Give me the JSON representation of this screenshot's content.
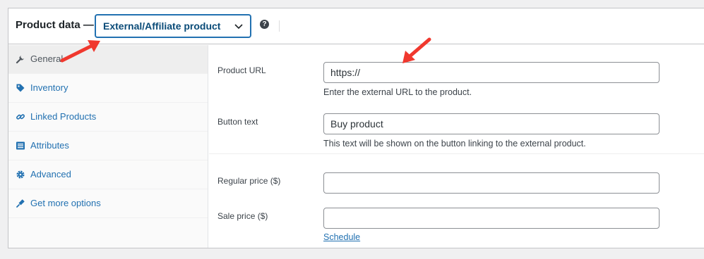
{
  "header": {
    "title": "Product data —",
    "product_type": "External/Affiliate product",
    "help": "?"
  },
  "sidebar": {
    "items": [
      {
        "label": "General",
        "icon": "wrench-icon",
        "active": true
      },
      {
        "label": "Inventory",
        "icon": "tag-icon",
        "active": false
      },
      {
        "label": "Linked Products",
        "icon": "link-icon",
        "active": false
      },
      {
        "label": "Attributes",
        "icon": "list-icon",
        "active": false
      },
      {
        "label": "Advanced",
        "icon": "gear-icon",
        "active": false
      },
      {
        "label": "Get more options",
        "icon": "plugin-icon",
        "active": false
      }
    ]
  },
  "fields": {
    "product_url": {
      "label": "Product URL",
      "value": "https://",
      "description": "Enter the external URL to the product."
    },
    "button_text": {
      "label": "Button text",
      "value": "Buy product",
      "description": "This text will be shown on the button linking to the external product."
    },
    "regular_price": {
      "label": "Regular price ($)",
      "value": ""
    },
    "sale_price": {
      "label": "Sale price ($)",
      "value": "",
      "schedule_link": "Schedule"
    }
  },
  "colors": {
    "accent": "#2271b1",
    "annotation_arrow": "#f0382e"
  }
}
